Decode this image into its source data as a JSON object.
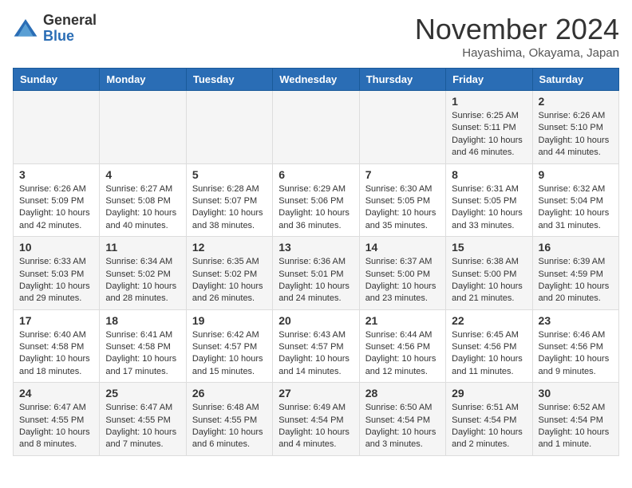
{
  "header": {
    "logo_line1": "General",
    "logo_line2": "Blue",
    "month": "November 2024",
    "location": "Hayashima, Okayama, Japan"
  },
  "weekdays": [
    "Sunday",
    "Monday",
    "Tuesday",
    "Wednesday",
    "Thursday",
    "Friday",
    "Saturday"
  ],
  "weeks": [
    [
      {
        "day": "",
        "content": ""
      },
      {
        "day": "",
        "content": ""
      },
      {
        "day": "",
        "content": ""
      },
      {
        "day": "",
        "content": ""
      },
      {
        "day": "",
        "content": ""
      },
      {
        "day": "1",
        "content": "Sunrise: 6:25 AM\nSunset: 5:11 PM\nDaylight: 10 hours\nand 46 minutes."
      },
      {
        "day": "2",
        "content": "Sunrise: 6:26 AM\nSunset: 5:10 PM\nDaylight: 10 hours\nand 44 minutes."
      }
    ],
    [
      {
        "day": "3",
        "content": "Sunrise: 6:26 AM\nSunset: 5:09 PM\nDaylight: 10 hours\nand 42 minutes."
      },
      {
        "day": "4",
        "content": "Sunrise: 6:27 AM\nSunset: 5:08 PM\nDaylight: 10 hours\nand 40 minutes."
      },
      {
        "day": "5",
        "content": "Sunrise: 6:28 AM\nSunset: 5:07 PM\nDaylight: 10 hours\nand 38 minutes."
      },
      {
        "day": "6",
        "content": "Sunrise: 6:29 AM\nSunset: 5:06 PM\nDaylight: 10 hours\nand 36 minutes."
      },
      {
        "day": "7",
        "content": "Sunrise: 6:30 AM\nSunset: 5:05 PM\nDaylight: 10 hours\nand 35 minutes."
      },
      {
        "day": "8",
        "content": "Sunrise: 6:31 AM\nSunset: 5:05 PM\nDaylight: 10 hours\nand 33 minutes."
      },
      {
        "day": "9",
        "content": "Sunrise: 6:32 AM\nSunset: 5:04 PM\nDaylight: 10 hours\nand 31 minutes."
      }
    ],
    [
      {
        "day": "10",
        "content": "Sunrise: 6:33 AM\nSunset: 5:03 PM\nDaylight: 10 hours\nand 29 minutes."
      },
      {
        "day": "11",
        "content": "Sunrise: 6:34 AM\nSunset: 5:02 PM\nDaylight: 10 hours\nand 28 minutes."
      },
      {
        "day": "12",
        "content": "Sunrise: 6:35 AM\nSunset: 5:02 PM\nDaylight: 10 hours\nand 26 minutes."
      },
      {
        "day": "13",
        "content": "Sunrise: 6:36 AM\nSunset: 5:01 PM\nDaylight: 10 hours\nand 24 minutes."
      },
      {
        "day": "14",
        "content": "Sunrise: 6:37 AM\nSunset: 5:00 PM\nDaylight: 10 hours\nand 23 minutes."
      },
      {
        "day": "15",
        "content": "Sunrise: 6:38 AM\nSunset: 5:00 PM\nDaylight: 10 hours\nand 21 minutes."
      },
      {
        "day": "16",
        "content": "Sunrise: 6:39 AM\nSunset: 4:59 PM\nDaylight: 10 hours\nand 20 minutes."
      }
    ],
    [
      {
        "day": "17",
        "content": "Sunrise: 6:40 AM\nSunset: 4:58 PM\nDaylight: 10 hours\nand 18 minutes."
      },
      {
        "day": "18",
        "content": "Sunrise: 6:41 AM\nSunset: 4:58 PM\nDaylight: 10 hours\nand 17 minutes."
      },
      {
        "day": "19",
        "content": "Sunrise: 6:42 AM\nSunset: 4:57 PM\nDaylight: 10 hours\nand 15 minutes."
      },
      {
        "day": "20",
        "content": "Sunrise: 6:43 AM\nSunset: 4:57 PM\nDaylight: 10 hours\nand 14 minutes."
      },
      {
        "day": "21",
        "content": "Sunrise: 6:44 AM\nSunset: 4:56 PM\nDaylight: 10 hours\nand 12 minutes."
      },
      {
        "day": "22",
        "content": "Sunrise: 6:45 AM\nSunset: 4:56 PM\nDaylight: 10 hours\nand 11 minutes."
      },
      {
        "day": "23",
        "content": "Sunrise: 6:46 AM\nSunset: 4:56 PM\nDaylight: 10 hours\nand 9 minutes."
      }
    ],
    [
      {
        "day": "24",
        "content": "Sunrise: 6:47 AM\nSunset: 4:55 PM\nDaylight: 10 hours\nand 8 minutes."
      },
      {
        "day": "25",
        "content": "Sunrise: 6:47 AM\nSunset: 4:55 PM\nDaylight: 10 hours\nand 7 minutes."
      },
      {
        "day": "26",
        "content": "Sunrise: 6:48 AM\nSunset: 4:55 PM\nDaylight: 10 hours\nand 6 minutes."
      },
      {
        "day": "27",
        "content": "Sunrise: 6:49 AM\nSunset: 4:54 PM\nDaylight: 10 hours\nand 4 minutes."
      },
      {
        "day": "28",
        "content": "Sunrise: 6:50 AM\nSunset: 4:54 PM\nDaylight: 10 hours\nand 3 minutes."
      },
      {
        "day": "29",
        "content": "Sunrise: 6:51 AM\nSunset: 4:54 PM\nDaylight: 10 hours\nand 2 minutes."
      },
      {
        "day": "30",
        "content": "Sunrise: 6:52 AM\nSunset: 4:54 PM\nDaylight: 10 hours\nand 1 minute."
      }
    ]
  ]
}
